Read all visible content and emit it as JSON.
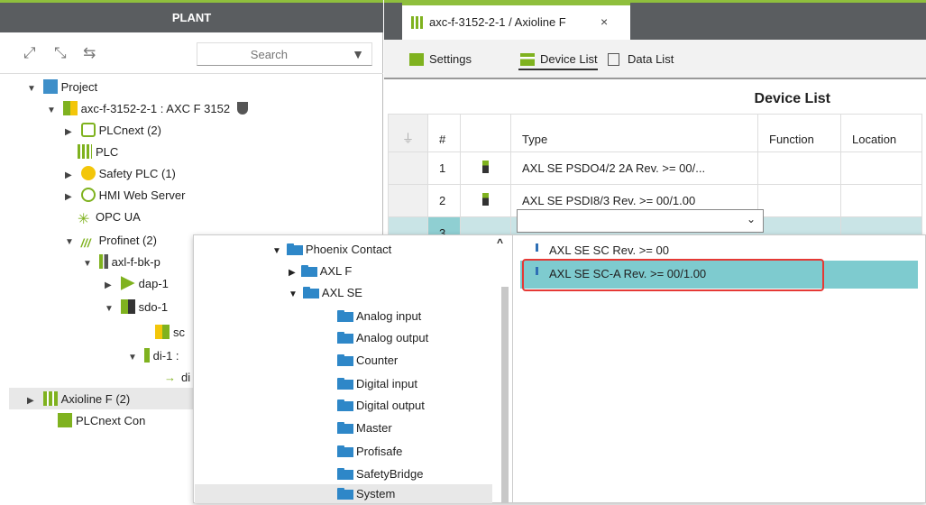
{
  "plant": {
    "header": "PLANT",
    "search_placeholder": "Search",
    "tree": [
      {
        "label": "Project"
      },
      {
        "label": "axc-f-3152-2-1 : AXC F 3152"
      },
      {
        "label": "PLCnext (2)"
      },
      {
        "label": "PLC"
      },
      {
        "label": "Safety PLC (1)"
      },
      {
        "label": "HMI Web Server"
      },
      {
        "label": "OPC UA"
      },
      {
        "label": "Profinet (2)"
      },
      {
        "label": "axl-f-bk-p"
      },
      {
        "label": "dap-1"
      },
      {
        "label": "sdo-1"
      },
      {
        "label": "sc"
      },
      {
        "label": "di-1 :"
      },
      {
        "label": "di"
      },
      {
        "label": "Axioline F (2)"
      },
      {
        "label": "PLCnext Con"
      }
    ]
  },
  "editor": {
    "tab_label": "axc-f-3152-2-1 / Axioline F",
    "tab_close": "×",
    "subtabs": [
      {
        "label": "Settings"
      },
      {
        "label": "Device List"
      },
      {
        "label": "Data List"
      }
    ],
    "title": "Device List",
    "columns": [
      "#",
      "Type",
      "Function",
      "Location"
    ],
    "rows": [
      {
        "index": "1",
        "type": "AXL SE PSDO4/2 2A Rev. >= 00/..."
      },
      {
        "index": "2",
        "type": "AXL SE PSDI8/3 Rev. >= 00/1.00"
      },
      {
        "index": "3",
        "type": ""
      }
    ]
  },
  "dropdown": {
    "tree": [
      {
        "label": "Phoenix Contact"
      },
      {
        "label": "AXL F"
      },
      {
        "label": "AXL SE"
      },
      {
        "label": "Analog input"
      },
      {
        "label": "Analog output"
      },
      {
        "label": "Counter"
      },
      {
        "label": "Digital input"
      },
      {
        "label": "Digital output"
      },
      {
        "label": "Master"
      },
      {
        "label": "Profisafe"
      },
      {
        "label": "SafetyBridge"
      },
      {
        "label": "System"
      }
    ],
    "results": [
      {
        "label": "AXL SE SC Rev. >= 00"
      },
      {
        "label": "AXL SE SC-A Rev. >= 00/1.00"
      }
    ]
  },
  "colors": {
    "accent": "#8fbf3d",
    "header_bg": "#5a5d60",
    "selection": "#7ecbcf",
    "highlight": "#e53935",
    "folder": "#2e87c8"
  }
}
